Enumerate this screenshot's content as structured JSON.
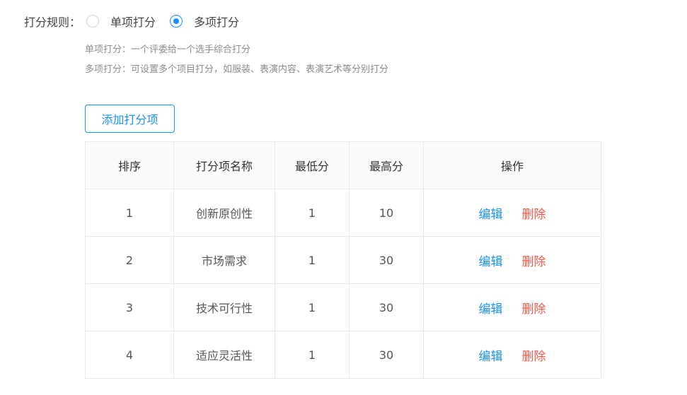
{
  "scoring_rule": {
    "label": "打分规则：",
    "options": [
      {
        "label": "单项打分",
        "checked": false
      },
      {
        "label": "多项打分",
        "checked": true
      }
    ],
    "descriptions": [
      "单项打分：一个评委给一个选手综合打分",
      "多项打分：可设置多个项目打分，如服装、表演内容、表演艺术等分别打分"
    ]
  },
  "add_button_label": "添加打分项",
  "table": {
    "headers": [
      "排序",
      "打分项名称",
      "最低分",
      "最高分",
      "操作"
    ],
    "rows": [
      {
        "order": "1",
        "name": "创新原创性",
        "min": "1",
        "max": "10"
      },
      {
        "order": "2",
        "name": "市场需求",
        "min": "1",
        "max": "30"
      },
      {
        "order": "3",
        "name": "技术可行性",
        "min": "1",
        "max": "30"
      },
      {
        "order": "4",
        "name": "适应灵活性",
        "min": "1",
        "max": "30"
      }
    ],
    "actions": {
      "edit": "编辑",
      "delete": "删除"
    }
  },
  "colors": {
    "accent": "#1890ff",
    "danger": "#f5584b"
  }
}
